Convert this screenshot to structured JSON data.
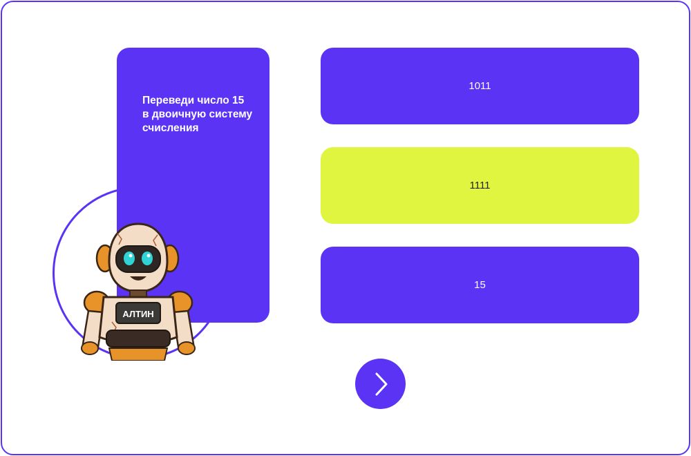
{
  "question": {
    "text": "Переведи число 15 в двоичную систему счисления"
  },
  "robot": {
    "badge": "АЛТИН"
  },
  "answers": [
    {
      "label": "1011",
      "state": "default"
    },
    {
      "label": "1111",
      "state": "selected"
    },
    {
      "label": "15",
      "state": "default"
    }
  ],
  "navigation": {
    "next_icon": "chevron-right-icon"
  },
  "colors": {
    "accent": "#5b33f5",
    "selected": "#dff53f",
    "text_on_accent": "#ffffff"
  }
}
